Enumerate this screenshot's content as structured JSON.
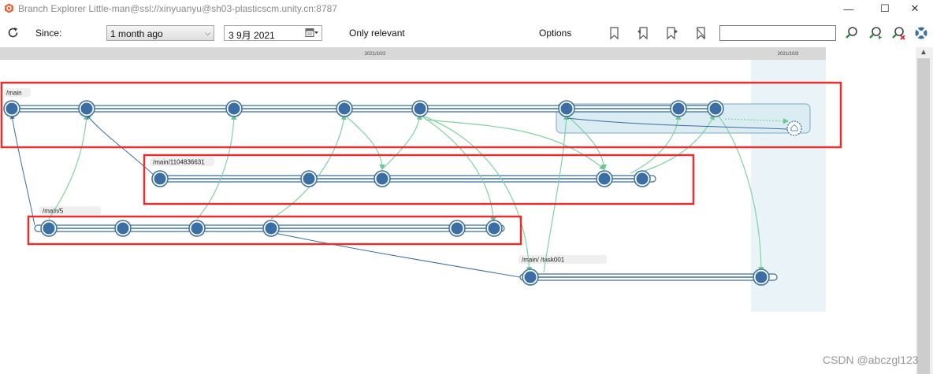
{
  "window": {
    "title": "Branch Explorer Little-man@ssl://xinyuanyu@sh03-plasticscm.unity.cn:8787",
    "minimize_glyph": "—",
    "maximize_glyph": "☐",
    "close_glyph": "✕"
  },
  "toolbar": {
    "since_label": "Since:",
    "since_value": "1 month ago",
    "date_value": "3 9月 2021",
    "only_relevant_label": "Only relevant",
    "options_label": "Options",
    "search_value": ""
  },
  "timeline": {
    "dates": [
      "2021/10/2",
      "2021/10/3"
    ]
  },
  "branches": [
    {
      "label": "/main"
    },
    {
      "label": "/main/1104836631"
    },
    {
      "label": "/main/5"
    },
    {
      "label": "/main/        /task001"
    }
  ],
  "icons": {
    "app": "plastic-logo-icon",
    "refresh": "refresh-icon",
    "calendar": "calendar-icon",
    "bookmarks": [
      "bookmark-icon",
      "bookmark-back-icon",
      "bookmark-forward-icon",
      "bookmark-clear-icon"
    ],
    "search_actions": [
      "search-icon",
      "search-next-icon",
      "search-clear-icon",
      "help-lifebuoy-icon"
    ]
  },
  "colors": {
    "node_fill": "#3a6ea5",
    "branch_line": "#3a6ea5",
    "merge_line": "#7fd3a0",
    "highlight_box": "#e53030",
    "current_date_band": "#eaf4f8"
  },
  "watermark": "CSDN @abczgl123"
}
